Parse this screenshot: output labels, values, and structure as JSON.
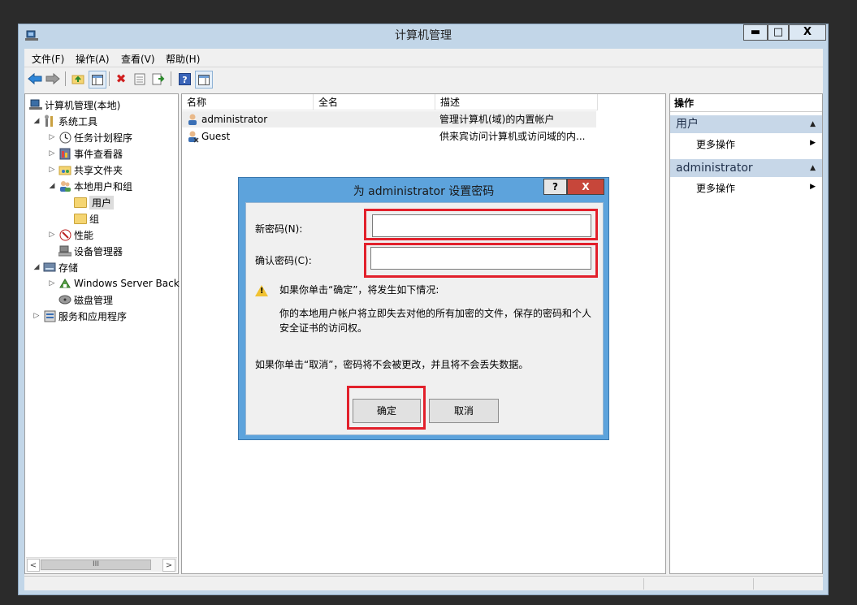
{
  "window": {
    "title": "计算机管理",
    "minimize_glyph": "▬",
    "maximize_glyph": "□",
    "close_glyph": "X"
  },
  "menu": [
    {
      "label": "文件(F)"
    },
    {
      "label": "操作(A)"
    },
    {
      "label": "查看(V)"
    },
    {
      "label": "帮助(H)"
    }
  ],
  "toolbar": {
    "icons": [
      "back-icon",
      "forward-icon",
      "up-folder-icon",
      "show-console-tree-icon",
      "delete-icon",
      "properties-icon",
      "export-list-icon",
      "help-icon",
      "show-action-pane-icon"
    ]
  },
  "tree": {
    "items": [
      {
        "label": "计算机管理(本地)"
      },
      {
        "label": "系统工具"
      },
      {
        "label": "任务计划程序"
      },
      {
        "label": "事件查看器"
      },
      {
        "label": "共享文件夹"
      },
      {
        "label": "本地用户和组"
      },
      {
        "label": "用户"
      },
      {
        "label": "组"
      },
      {
        "label": "性能"
      },
      {
        "label": "设备管理器"
      },
      {
        "label": "存储"
      },
      {
        "label": "Windows Server Back"
      },
      {
        "label": "磁盘管理"
      },
      {
        "label": "服务和应用程序"
      }
    ],
    "scroll_thumb": "III"
  },
  "list": {
    "columns": [
      "名称",
      "全名",
      "描述"
    ],
    "rows": [
      {
        "name": "administrator",
        "fullname": "",
        "description": "管理计算机(域)的内置帐户"
      },
      {
        "name": "Guest",
        "fullname": "",
        "description": "供来宾访问计算机或访问域的内..."
      }
    ]
  },
  "actions": {
    "header": "操作",
    "sections": [
      {
        "title": "用户",
        "item": "更多操作"
      },
      {
        "title": "administrator",
        "item": "更多操作"
      }
    ]
  },
  "dialog": {
    "title": "为 administrator 设置密码",
    "help_label": "?",
    "close_label": "X",
    "new_password_label": "新密码(N):",
    "confirm_password_label": "确认密码(C):",
    "new_password_value": "",
    "confirm_password_value": "",
    "warning_line1": "如果你单击“确定”，将发生如下情况:",
    "warning_line2": "你的本地用户帐户将立即失去对他的所有加密的文件，保存的密码和个人",
    "warning_line3": "安全证书的访问权。",
    "cancel_note": "如果你单击“取消”，密码将不会被更改，并且将不会丢失数据。",
    "ok_label": "确定",
    "cancel_label": "取消",
    "highlight_color": "#e2202b"
  }
}
